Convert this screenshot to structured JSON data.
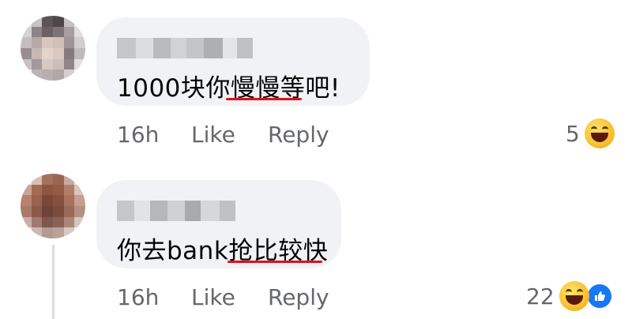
{
  "comments": [
    {
      "text": "1000块你慢慢等吧!",
      "time": "16h",
      "like_label": "Like",
      "reply_label": "Reply",
      "reaction_count": "5",
      "reaction_icons": [
        "haha-reaction-icon"
      ]
    },
    {
      "text": "你去bank抢比较快",
      "time": "16h",
      "like_label": "Like",
      "reply_label": "Reply",
      "reaction_count": "22",
      "reaction_icons": [
        "haha-reaction-icon",
        "like-reaction-icon"
      ]
    }
  ],
  "colors": {
    "bubble": "#f0f2f5",
    "meta_text": "#65676b",
    "underline": "#e0101a",
    "like_blue": "#1877f2"
  }
}
